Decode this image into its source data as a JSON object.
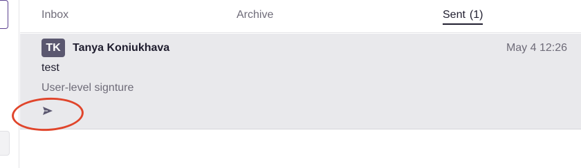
{
  "tabs": [
    {
      "label": "Inbox"
    },
    {
      "label": "Archive"
    },
    {
      "label": "Sent",
      "count": "(1)",
      "active": true
    }
  ],
  "message": {
    "avatar_initials": "TK",
    "sender": "Tanya Koniukhava",
    "date": "May 4 12:26",
    "subject": "test",
    "snippet": "User-level signture",
    "status_icon": "paper-plane-icon"
  },
  "annotation": {
    "shape": "ellipse",
    "color": "#e0452b",
    "target": "sent-status-icon"
  },
  "colors": {
    "row_background": "#e9e9ec",
    "avatar_background": "#5b5870",
    "active_tab_underline": "#1f1d2e",
    "sidebar_accent": "#5a3f8f"
  }
}
